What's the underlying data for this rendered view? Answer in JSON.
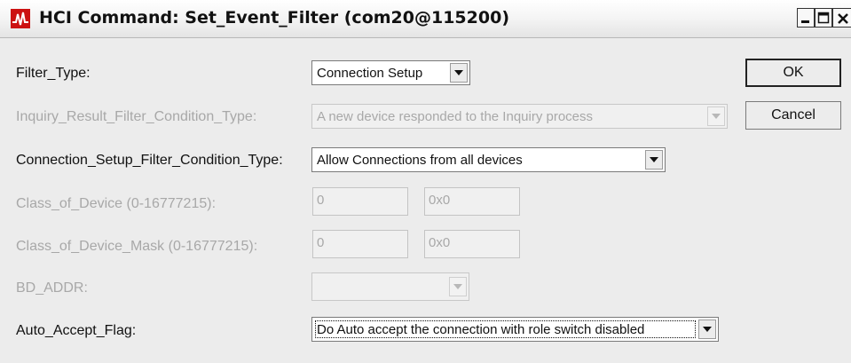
{
  "window": {
    "title": "HCI Command: Set_Event_Filter (com20@115200)",
    "icon": "app-logo-icon",
    "controls": [
      "minimize-icon",
      "maximize-icon",
      "close-icon"
    ]
  },
  "fields": {
    "filter_type": {
      "label": "Filter_Type:",
      "value": "Connection Setup",
      "enabled": true
    },
    "inquiry_condition": {
      "label": "Inquiry_Result_Filter_Condition_Type:",
      "value": "A new device responded to the Inquiry process",
      "enabled": false
    },
    "connection_condition": {
      "label": "Connection_Setup_Filter_Condition_Type:",
      "value": "Allow Connections from all devices",
      "enabled": true
    },
    "class_of_device": {
      "label": "Class_of_Device (0-16777215):",
      "decimal": "0",
      "hex": "0x0",
      "enabled": false
    },
    "class_of_device_mask": {
      "label": "Class_of_Device_Mask (0-16777215):",
      "decimal": "0",
      "hex": "0x0",
      "enabled": false
    },
    "bd_addr": {
      "label": "BD_ADDR:",
      "value": "",
      "enabled": false
    },
    "auto_accept": {
      "label": "Auto_Accept_Flag:",
      "value": "Do Auto accept the connection with role switch disabled",
      "enabled": true
    }
  },
  "buttons": {
    "ok": "OK",
    "cancel": "Cancel"
  },
  "colors": {
    "window_bg": "#ececec",
    "disabled_text": "#a8a8a8",
    "icon_red": "#cc1111"
  }
}
